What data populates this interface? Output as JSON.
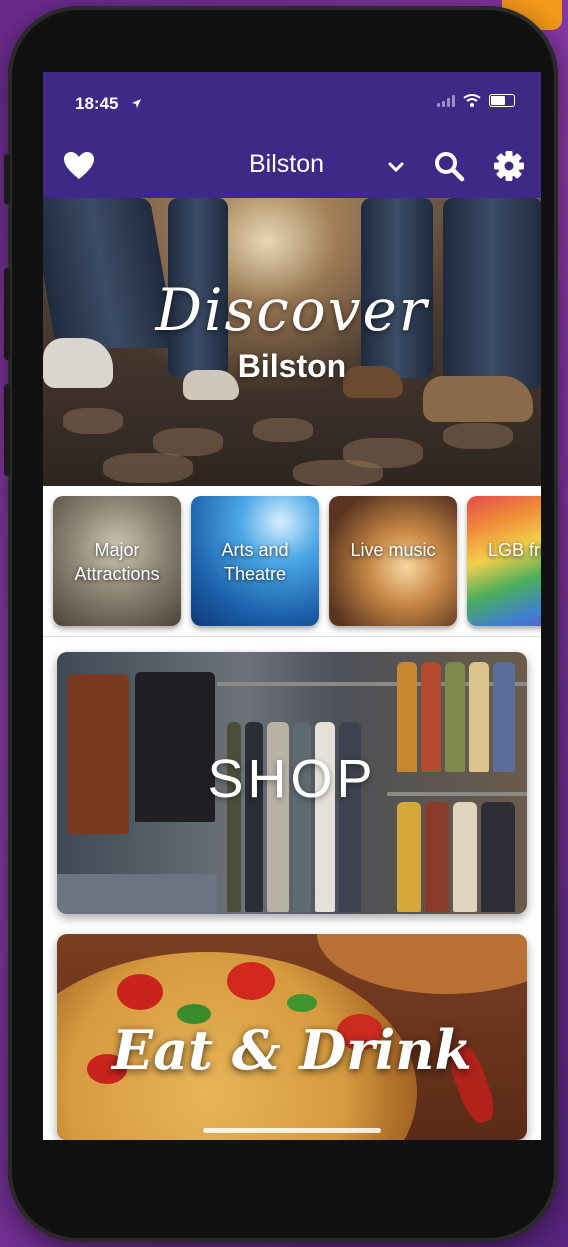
{
  "status": {
    "time": "18:45"
  },
  "nav": {
    "location": "Bilston"
  },
  "hero": {
    "script": "Discover",
    "subtitle": "Bilston"
  },
  "categories": [
    {
      "label": "Major Attractions"
    },
    {
      "label": "Arts and Theatre"
    },
    {
      "label": "Live music"
    },
    {
      "label": "LGB friend"
    }
  ],
  "features": {
    "shop": "SHOP",
    "eat": "Eat & Drink"
  },
  "colors": {
    "header": "#3e2a86",
    "accent": "#f59a1b",
    "background": "#7b3497"
  },
  "icons": [
    "heart-icon",
    "chevron-down-icon",
    "search-icon",
    "gear-icon",
    "location-arrow-icon",
    "wifi-icon",
    "battery-icon"
  ]
}
